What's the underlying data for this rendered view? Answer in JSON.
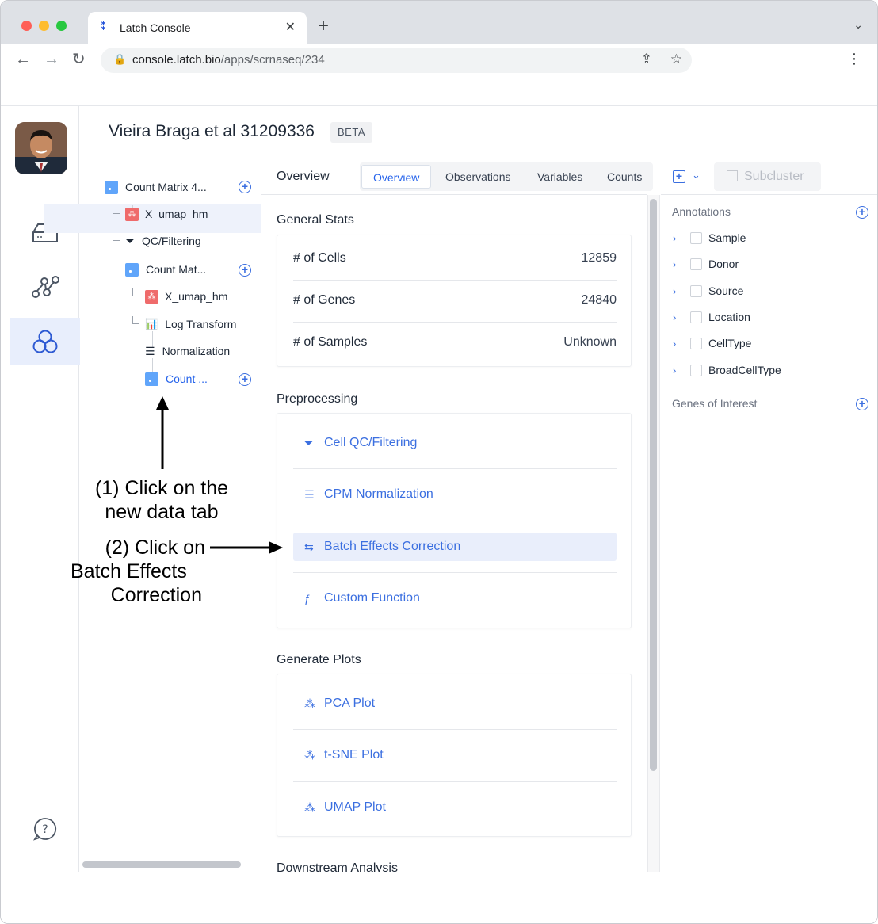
{
  "browser": {
    "tab_title": "Latch Console",
    "tab_icon": "latch-logo-icon",
    "url_host": "console.latch.bio",
    "url_path": "/apps/scrnaseq/234"
  },
  "header": {
    "title": "Vieira Braga et al 31209336",
    "badge": "BETA"
  },
  "tree": {
    "items": [
      {
        "label": "Count Matrix 4...",
        "icon": "matrix-icon"
      },
      {
        "label": "X_umap_hm",
        "icon": "umap-icon"
      },
      {
        "label": "QC/Filtering",
        "icon": "filter-icon"
      },
      {
        "label": "Count Mat...",
        "icon": "matrix-icon"
      },
      {
        "label": "X_umap_hm",
        "icon": "umap-icon"
      },
      {
        "label": "Log Transform",
        "icon": "bar-chart-icon"
      },
      {
        "label": "Normalization",
        "icon": "list-icon"
      },
      {
        "label": "Count ...",
        "icon": "matrix-icon"
      }
    ]
  },
  "main": {
    "section_title": "Overview",
    "tabs": [
      {
        "label": "Overview",
        "active": true
      },
      {
        "label": "Observations",
        "active": false
      },
      {
        "label": "Variables",
        "active": false
      },
      {
        "label": "Counts",
        "active": false
      }
    ],
    "general_stats": {
      "title": "General Stats",
      "rows": [
        {
          "label": "# of Cells",
          "value": "12859"
        },
        {
          "label": "# of Genes",
          "value": "24840"
        },
        {
          "label": "# of Samples",
          "value": "Unknown"
        }
      ]
    },
    "preprocessing": {
      "title": "Preprocessing",
      "items": [
        {
          "label": "Cell QC/Filtering",
          "icon": "filter-icon"
        },
        {
          "label": "CPM Normalization",
          "icon": "list-icon"
        },
        {
          "label": "Batch Effects Correction",
          "icon": "merge-icon",
          "highlighted": true
        },
        {
          "label": "Custom Function",
          "icon": "function-icon"
        }
      ]
    },
    "plots": {
      "title": "Generate Plots",
      "items": [
        {
          "label": "PCA Plot",
          "icon": "scatter-icon"
        },
        {
          "label": "t-SNE Plot",
          "icon": "scatter-icon"
        },
        {
          "label": "UMAP Plot",
          "icon": "scatter-icon"
        }
      ]
    },
    "downstream": {
      "title": "Downstream Analysis"
    }
  },
  "right": {
    "subcluster_label": "Subcluster",
    "annotations_title": "Annotations",
    "annotations": [
      "Sample",
      "Donor",
      "Source",
      "Location",
      "CellType",
      "BroadCellType"
    ],
    "genes_title": "Genes of Interest"
  },
  "callouts": {
    "step1": [
      "(1) Click on the",
      "new data tab"
    ],
    "step2": [
      "(2) Click on",
      "Batch Effects",
      "Correction"
    ]
  },
  "colors": {
    "accent": "#3b6fe0",
    "selected_bg": "#e9eefb",
    "matrix_icon": "#60a5fa",
    "umap_icon": "#ef6b6b"
  }
}
